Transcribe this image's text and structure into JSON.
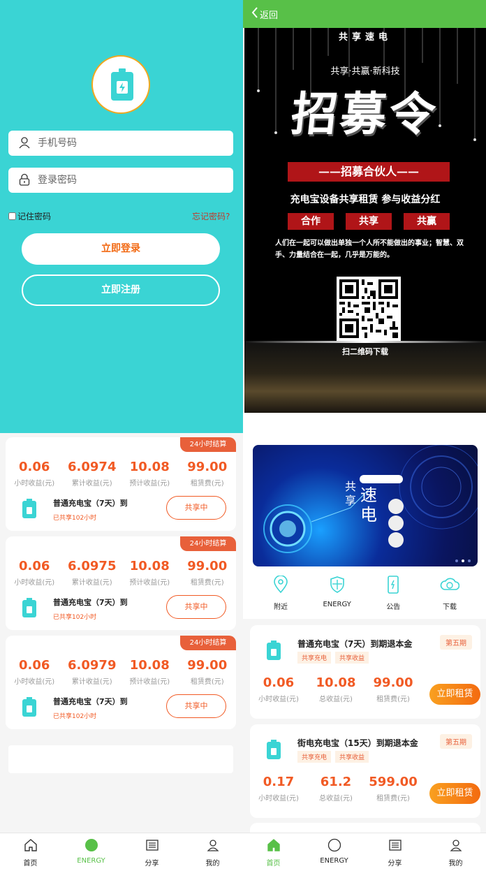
{
  "login": {
    "phone_placeholder": "手机号码",
    "password_placeholder": "登录密码",
    "remember_label": "记住密码",
    "forgot_label": "忘记密码?",
    "login_button": "立即登录",
    "register_button": "立即注册"
  },
  "poster_page": {
    "back_label": "返回",
    "brand": "共享速电",
    "subtitle": "共享·共赢·新科技",
    "headline": "招募令",
    "banner": "——招募合伙人——",
    "line2": "充电宝设备共享租赁 参与收益分红",
    "tags": [
      "合作",
      "共享",
      "共赢"
    ],
    "paragraph": "人们在一起可以做出单独一个人所不能做出的事业；智慧、双手、力量结合在一起，几乎是万能的。",
    "scan_label": "扫二维码下载"
  },
  "orders": [
    {
      "badge": "24小时结算",
      "stats": [
        {
          "value": "0.06",
          "label": "小时收益(元)"
        },
        {
          "value": "6.0974",
          "label": "累计收益(元)"
        },
        {
          "value": "10.08",
          "label": "预计收益(元)"
        },
        {
          "value": "99.00",
          "label": "租赁费(元)"
        }
      ],
      "name": "普通充电宝（7天）到",
      "shared": "已共享102小时",
      "button": "共享中"
    },
    {
      "badge": "24小时结算",
      "stats": [
        {
          "value": "0.06",
          "label": "小时收益(元)"
        },
        {
          "value": "6.0975",
          "label": "累计收益(元)"
        },
        {
          "value": "10.08",
          "label": "预计收益(元)"
        },
        {
          "value": "99.00",
          "label": "租赁费(元)"
        }
      ],
      "name": "普通充电宝（7天）到",
      "shared": "已共享102小时",
      "button": "共享中"
    },
    {
      "badge": "24小时结算",
      "stats": [
        {
          "value": "0.06",
          "label": "小时收益(元)"
        },
        {
          "value": "6.0979",
          "label": "累计收益(元)"
        },
        {
          "value": "10.08",
          "label": "预计收益(元)"
        },
        {
          "value": "99.00",
          "label": "租赁费(元)"
        }
      ],
      "name": "普通充电宝（7天）到",
      "shared": "已共享102小时",
      "button": "共享中"
    }
  ],
  "home": {
    "banner": {
      "word1": "共",
      "word2": "享",
      "word3": "速",
      "word4": "电"
    },
    "quick": [
      {
        "label": "附近",
        "icon": "location-icon"
      },
      {
        "label": "ENERGY",
        "icon": "shield-icon"
      },
      {
        "label": "公告",
        "icon": "phone-charge-icon"
      },
      {
        "label": "下载",
        "icon": "cloud-download-icon"
      }
    ],
    "products": [
      {
        "title": "普通充电宝（7天）到期退本金",
        "chips": [
          "共享充电",
          "共享收益"
        ],
        "period": "第五期",
        "stats": [
          {
            "value": "0.06",
            "label": "小时收益(元)"
          },
          {
            "value": "10.08",
            "label": "总收益(元)"
          },
          {
            "value": "99.00",
            "label": "租赁费(元)"
          }
        ],
        "button": "立即租赁"
      },
      {
        "title": "街电充电宝（15天）到期退本金",
        "chips": [
          "共享充电",
          "共享收益"
        ],
        "period": "第五期",
        "stats": [
          {
            "value": "0.17",
            "label": "小时收益(元)"
          },
          {
            "value": "61.2",
            "label": "总收益(元)"
          },
          {
            "value": "599.00",
            "label": "租赁费(元)"
          }
        ],
        "button": "立即租赁"
      }
    ]
  },
  "tabs_left": {
    "items": [
      {
        "label": "首页",
        "icon": "home-icon"
      },
      {
        "label": "ENERGY",
        "icon": "energy-dot-icon"
      },
      {
        "label": "分享",
        "icon": "share-list-icon"
      },
      {
        "label": "我的",
        "icon": "user-icon"
      }
    ],
    "active": "ENERGY"
  },
  "tabs_right": {
    "items": [
      {
        "label": "首页",
        "icon": "home-icon"
      },
      {
        "label": "ENERGY",
        "icon": "energy-dot-icon"
      },
      {
        "label": "分享",
        "icon": "share-list-icon"
      },
      {
        "label": "我的",
        "icon": "user-icon"
      }
    ],
    "active": "首页"
  },
  "colors": {
    "teal": "#3ad4d4",
    "green": "#58c048",
    "orange": "#f15a24",
    "poster_red": "#b01518"
  }
}
